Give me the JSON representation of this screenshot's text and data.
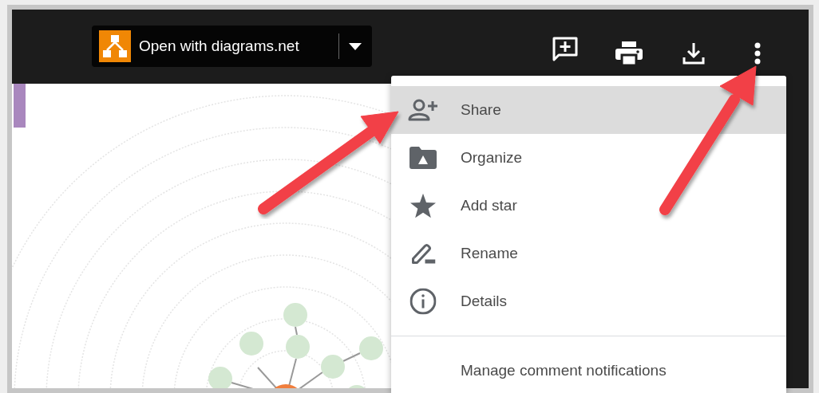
{
  "toolbar": {
    "open_button": {
      "label": "Open with diagrams.net"
    }
  },
  "menu": {
    "sections": [
      [
        {
          "label": "Share",
          "selected": true
        },
        {
          "label": "Organize",
          "selected": false
        },
        {
          "label": "Add star",
          "selected": false
        },
        {
          "label": "Rename",
          "selected": false
        },
        {
          "label": "Details",
          "selected": false
        }
      ],
      [
        {
          "label": "Manage comment notifications",
          "selected": false
        }
      ]
    ]
  }
}
